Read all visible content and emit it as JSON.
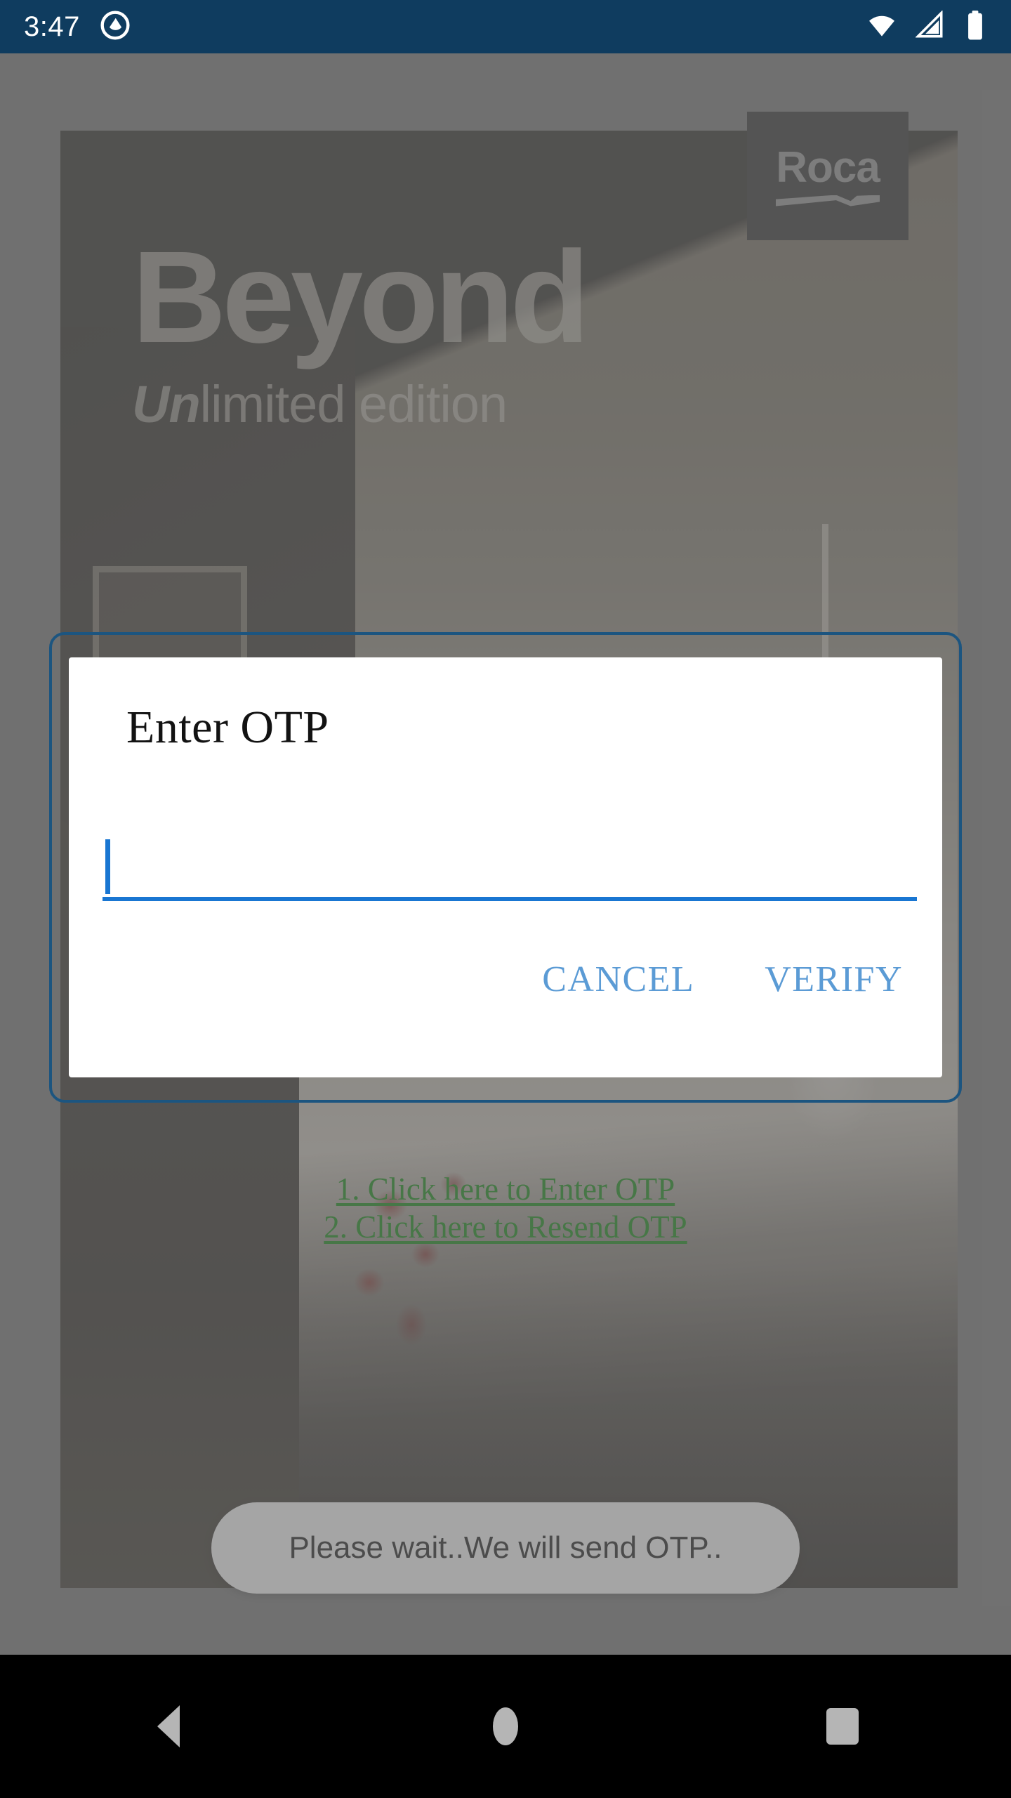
{
  "status_bar": {
    "time": "3:47",
    "app_icon": "circular-app-icon",
    "wifi_icon": "wifi-icon",
    "signal_icon": "cellular-signal-icon",
    "battery_icon": "battery-full-icon",
    "background_color": "#0F3C5F"
  },
  "promo": {
    "headline": "Beyond",
    "subline_italic": "Un",
    "subline_rest": "limited edition",
    "brand": "Roca"
  },
  "links": [
    {
      "label": "1. Click here to Enter OTP",
      "color": "#127d12"
    },
    {
      "label": "2. Click here to Resend OTP",
      "color": "#127d12"
    }
  ],
  "toast": {
    "message": "Please wait..We will send OTP.."
  },
  "dialog": {
    "title": "Enter OTP",
    "input_value": "",
    "input_placeholder": "",
    "cancel_label": "CANCEL",
    "verify_label": "VERIFY",
    "border_color": "#1C5580",
    "accent_color": "#1976D2",
    "button_color": "#5B9BD5"
  },
  "nav_bar": {
    "back_label": "Back",
    "home_label": "Home",
    "recents_label": "Recents"
  }
}
